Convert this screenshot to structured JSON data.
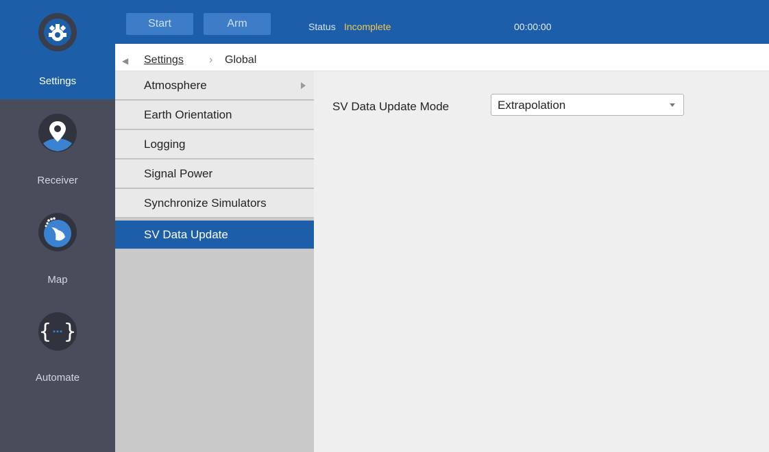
{
  "nav": {
    "items": [
      {
        "label": "Settings",
        "icon": "gear-icon",
        "active": true
      },
      {
        "label": "Receiver",
        "icon": "location-pin-icon",
        "active": false
      },
      {
        "label": "Map",
        "icon": "globe-icon",
        "active": false
      },
      {
        "label": "Automate",
        "icon": "braces-icon",
        "active": false
      }
    ]
  },
  "toolbar": {
    "start_label": "Start",
    "arm_label": "Arm",
    "status_label": "Status",
    "status_value": "Incomplete",
    "status_color": "#f2c94c",
    "timer": "00:00:00"
  },
  "breadcrumb": {
    "parent": "Settings",
    "separator": "›",
    "current": "Global"
  },
  "submenu": {
    "items": [
      {
        "label": "Atmosphere",
        "has_children": true
      },
      {
        "label": "Earth Orientation"
      },
      {
        "label": "Logging"
      },
      {
        "label": "Signal Power"
      },
      {
        "label": "Synchronize Simulators"
      },
      {
        "label": "SV Data Update",
        "active": true
      }
    ]
  },
  "content": {
    "field_label": "SV Data Update Mode",
    "dropdown_value": "Extrapolation"
  },
  "colors": {
    "accent": "#1c5ea9",
    "rail": "#484c5b",
    "submenu_bg": "#c9c9c9"
  }
}
